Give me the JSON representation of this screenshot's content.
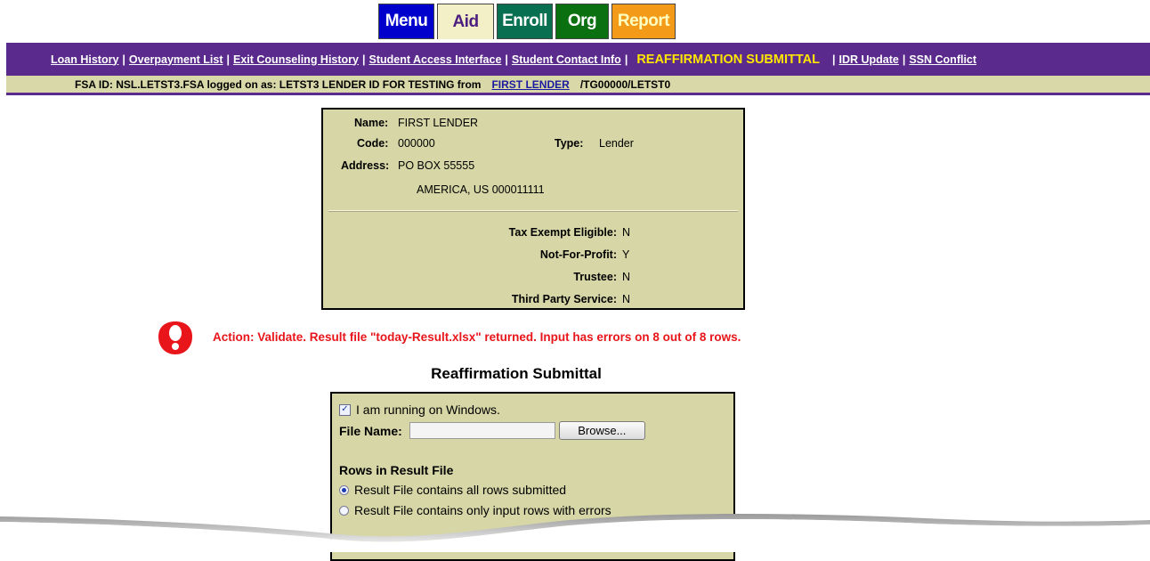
{
  "tabs": [
    {
      "label": "Menu",
      "color": "#0000cc"
    },
    {
      "label": "Aid",
      "color": "#f3f0c8",
      "active": true
    },
    {
      "label": "Enroll",
      "color": "#087050"
    },
    {
      "label": "Org",
      "color": "#0a7010"
    },
    {
      "label": "Report",
      "color": "#f39a18"
    }
  ],
  "nav": {
    "loan_history": "Loan History",
    "overpayment_list": "Overpayment List",
    "exit_counseling": "Exit Counseling History",
    "student_access": "Student Access Interface",
    "student_contact": "Student Contact Info",
    "current": "REAFFIRMATION SUBMITTAL",
    "idr_update": "IDR Update",
    "ssn_conflict": "SSN Conflict",
    "separator": "|"
  },
  "session": {
    "prefix": "FSA ID: NSL.LETST3.FSA logged on as: LETST3 LENDER ID FOR TESTING from",
    "org_link": "FIRST LENDER",
    "suffix": "/TG00000/LETST0"
  },
  "org_info": {
    "name_label": "Name:",
    "name_value": "FIRST LENDER",
    "code_label": "Code:",
    "code_value": "000000",
    "type_label": "Type:",
    "type_value": "Lender",
    "address_label": "Address:",
    "address_line1": "PO BOX  55555",
    "address_line2": "AMERICA,  US  000011111",
    "tax_exempt_label": "Tax Exempt Eligible:",
    "tax_exempt_value": "N",
    "nfp_label": "Not-For-Profit:",
    "nfp_value": "Y",
    "trustee_label": "Trustee:",
    "trustee_value": "N",
    "third_party_label": "Third Party Service:",
    "third_party_value": "N"
  },
  "error": {
    "icon": "error-exclamation-icon",
    "color": "#e8151b",
    "message": "Action: Validate. Result file \"today-Result.xlsx\" returned. Input has errors on 8 out of 8 rows."
  },
  "form": {
    "title": "Reaffirmation Submittal",
    "windows_label": "I am running on Windows.",
    "windows_checked": true,
    "file_name_label": "File Name:",
    "file_name_value": "",
    "browse_label": "Browse...",
    "rows_heading": "Rows in Result File",
    "option_all": "Result File contains all rows submitted",
    "option_errors": "Result File contains only input rows with errors",
    "selected_option": "all"
  }
}
